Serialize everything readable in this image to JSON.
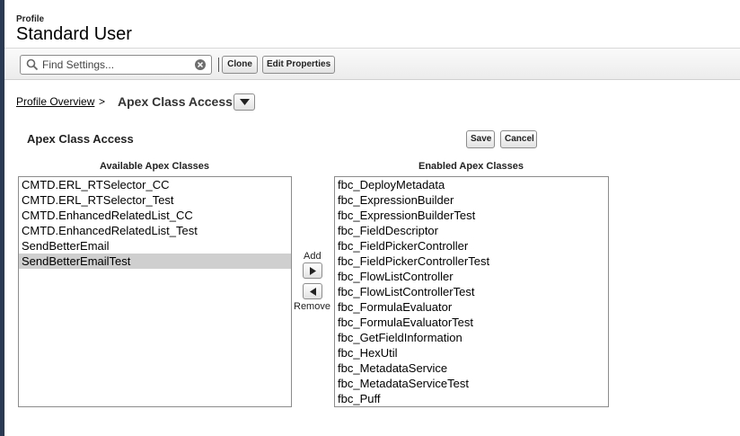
{
  "header": {
    "subtitle": "Profile",
    "title": "Standard User"
  },
  "toolbar": {
    "search_placeholder": "Find Settings...",
    "clone_label": "Clone",
    "edit_properties_label": "Edit Properties"
  },
  "breadcrumb": {
    "link": "Profile Overview",
    "separator": ">",
    "current": "Apex Class Access"
  },
  "section": {
    "title": "Apex Class Access",
    "save_label": "Save",
    "cancel_label": "Cancel"
  },
  "available": {
    "header": "Available Apex Classes",
    "items": [
      "CMTD.ERL_RTSelector_CC",
      "CMTD.ERL_RTSelector_Test",
      "CMTD.EnhancedRelatedList_CC",
      "CMTD.EnhancedRelatedList_Test",
      "SendBetterEmail",
      "SendBetterEmailTest"
    ],
    "selected_index": 5
  },
  "mover": {
    "add_label": "Add",
    "remove_label": "Remove"
  },
  "enabled": {
    "header": "Enabled Apex Classes",
    "items": [
      "fbc_DeployMetadata",
      "fbc_ExpressionBuilder",
      "fbc_ExpressionBuilderTest",
      "fbc_FieldDescriptor",
      "fbc_FieldPickerController",
      "fbc_FieldPickerControllerTest",
      "fbc_FlowListController",
      "fbc_FlowListControllerTest",
      "fbc_FormulaEvaluator",
      "fbc_FormulaEvaluatorTest",
      "fbc_GetFieldInformation",
      "fbc_HexUtil",
      "fbc_MetadataService",
      "fbc_MetadataServiceTest",
      "fbc_Puff"
    ]
  },
  "colors": {
    "sidebar_edge": "#2a3a55",
    "selection": "#cfcfcf",
    "border": "#8c8c8c"
  },
  "icons": {
    "search": "search-icon",
    "clear": "clear-icon",
    "dropdown": "chevron-down-icon",
    "add": "arrow-right-icon",
    "remove": "arrow-left-icon"
  }
}
